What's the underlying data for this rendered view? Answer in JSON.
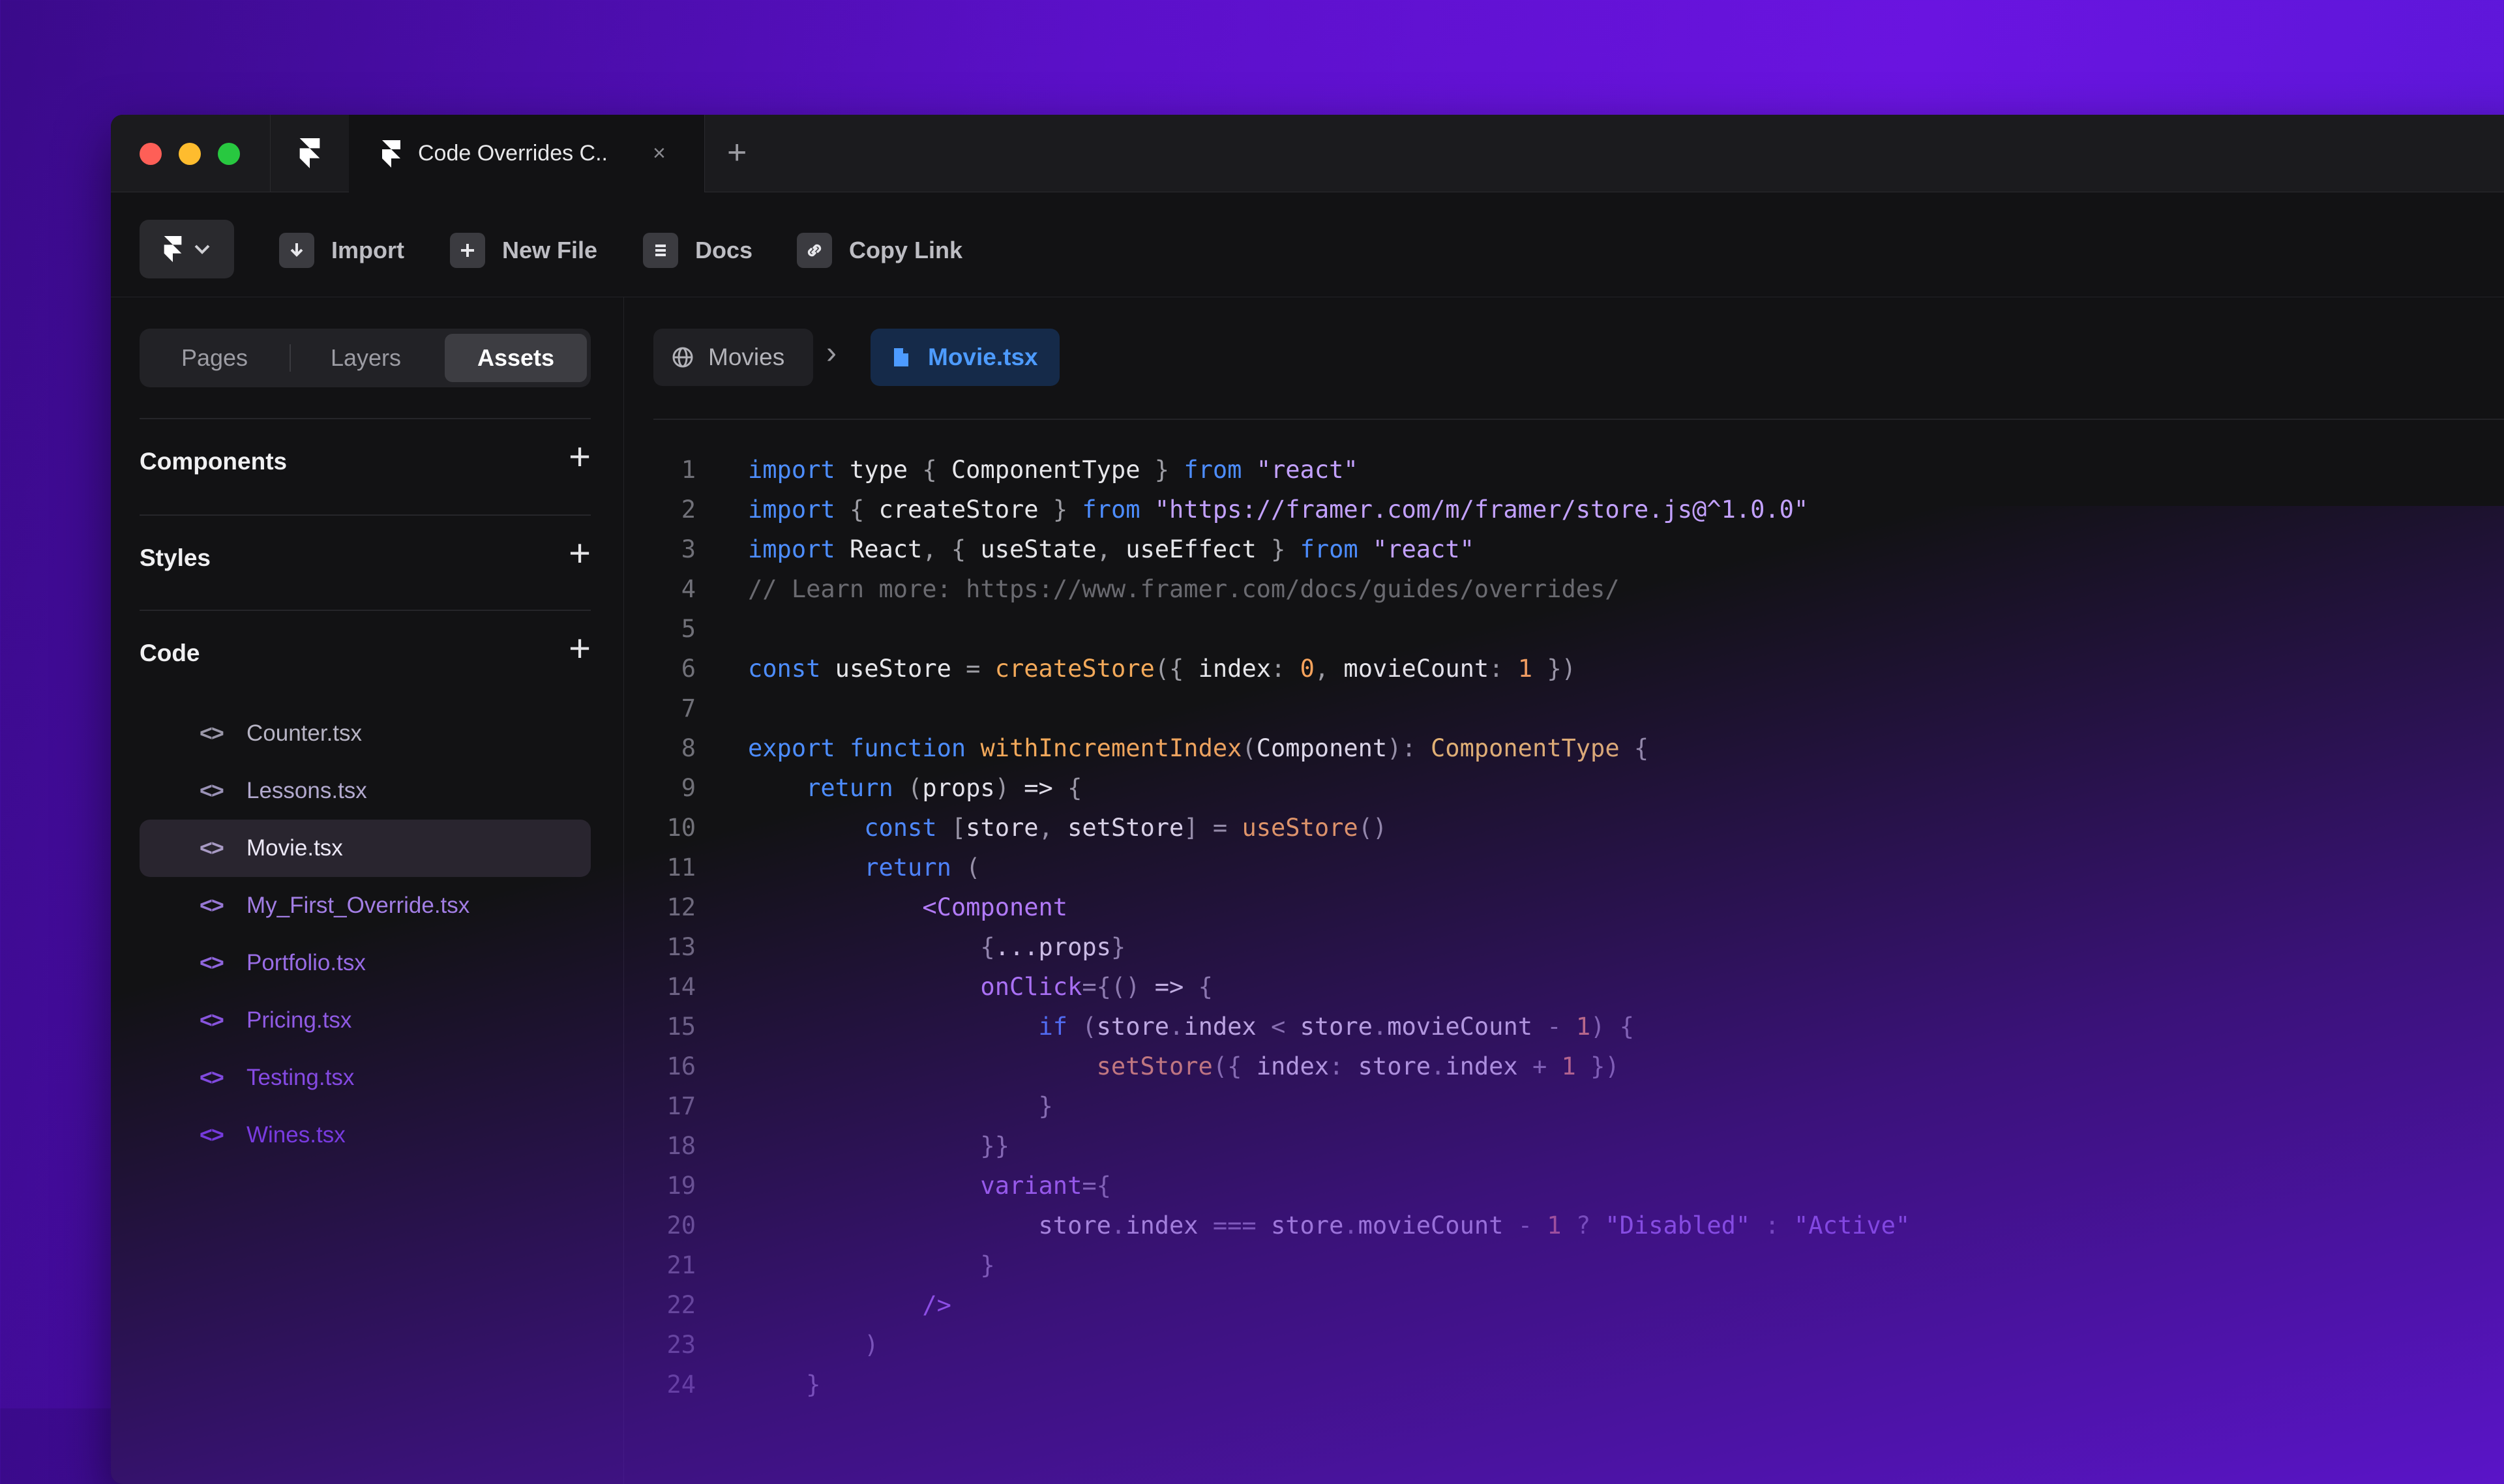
{
  "tab": {
    "title": "Code Overrides C..",
    "close": "×",
    "new": "+"
  },
  "toolbar": {
    "import_label": "Import",
    "new_file_label": "New File",
    "docs_label": "Docs",
    "copy_link_label": "Copy Link"
  },
  "sidebar": {
    "segments": [
      "Pages",
      "Layers",
      "Assets"
    ],
    "active_segment": "Assets",
    "sections": {
      "components": "Components",
      "styles": "Styles",
      "code": "Code"
    },
    "plus": "+",
    "code_icon": "<>",
    "files": [
      "Counter.tsx",
      "Lessons.tsx",
      "Movie.tsx",
      "My_First_Override.tsx",
      "Portfolio.tsx",
      "Pricing.tsx",
      "Testing.tsx",
      "Wines.tsx"
    ],
    "selected_file": "Movie.tsx"
  },
  "editor": {
    "crumb_folder": "Movies",
    "crumb_sep": "›",
    "crumb_file": "Movie.tsx",
    "line_numbers": [
      "1",
      "2",
      "3",
      "4",
      "5",
      "6",
      "7",
      "8",
      "9",
      "10",
      "11",
      "12",
      "13",
      "14",
      "15",
      "16",
      "17",
      "18",
      "19",
      "20",
      "21",
      "22",
      "23",
      "24"
    ]
  },
  "colors": {
    "accent_blue": "#4d9bff",
    "keyword": "#4d8dff",
    "string": "#c3a1ff",
    "function": "#f3a95a",
    "background": "#121214"
  }
}
